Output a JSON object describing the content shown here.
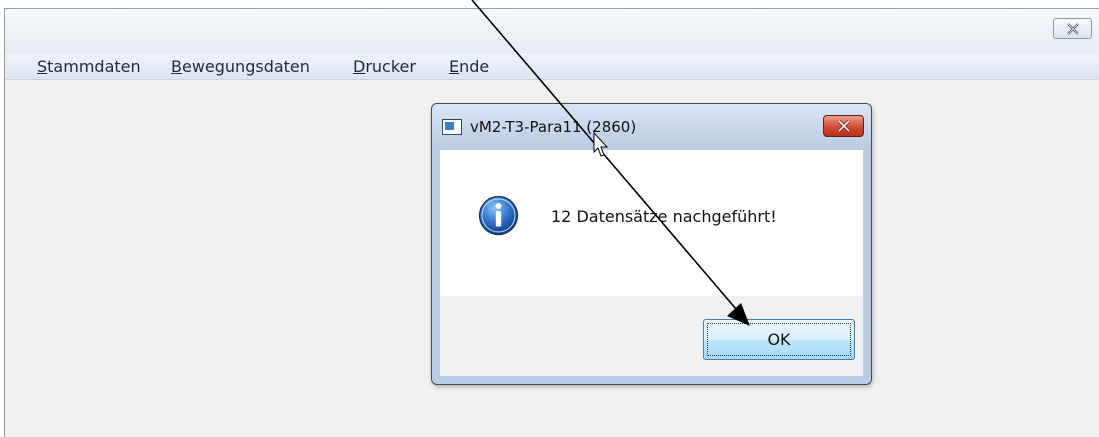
{
  "main_window": {
    "menu": [
      {
        "accel": "S",
        "rest": "tammdaten"
      },
      {
        "accel": "B",
        "rest": "ewegungsdaten"
      },
      {
        "accel": "D",
        "rest": "rucker"
      },
      {
        "accel": "E",
        "rest": "nde"
      }
    ],
    "close_icon": "close-icon"
  },
  "dialog": {
    "title": "vM2-T3-Para11 (2860)",
    "message": "12 Datensätze nachgeführt!",
    "ok_label": "OK",
    "app_icon": "app-window-icon",
    "info_icon": "info-icon",
    "close_icon": "close-icon"
  },
  "colors": {
    "dialog_close": "#c7432b",
    "ok_button_border": "#3c7fb1",
    "info_icon": "#1f5fb4"
  }
}
